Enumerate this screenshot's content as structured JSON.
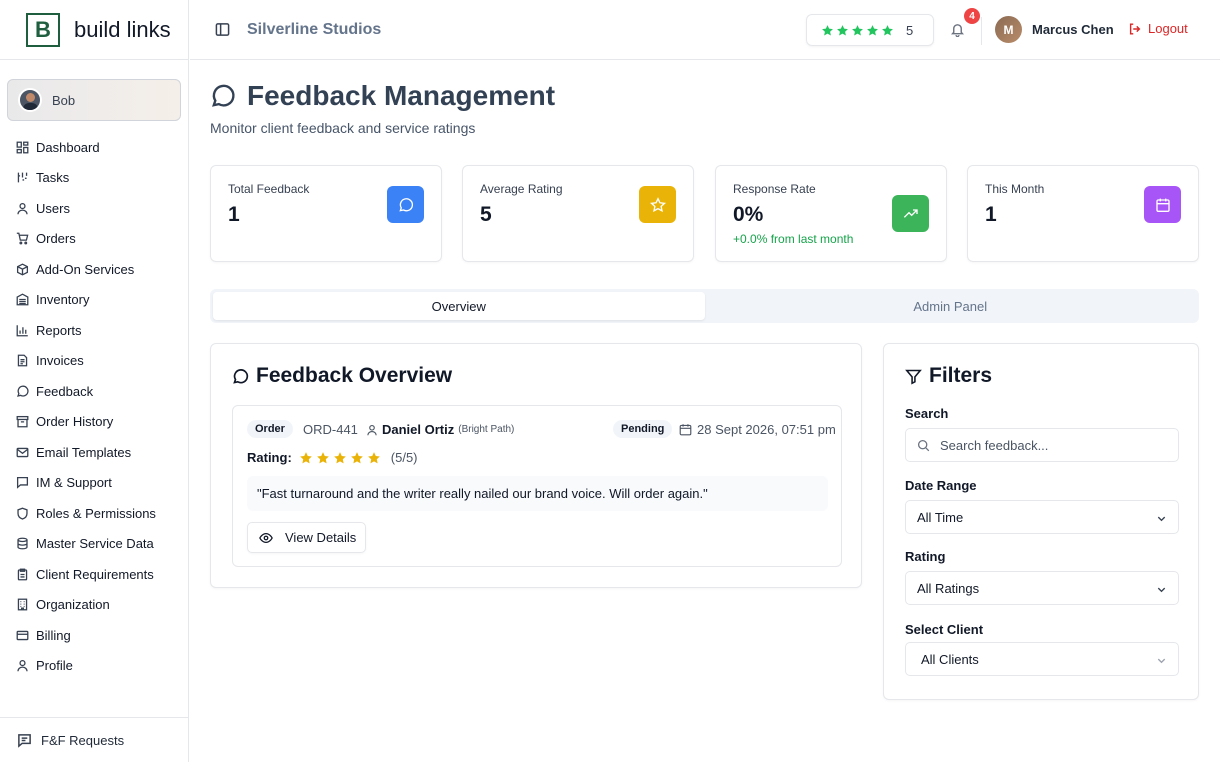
{
  "brand": {
    "logo_letter": "B",
    "name": "build links"
  },
  "sidebar": {
    "user": "Bob",
    "items": [
      {
        "label": "Dashboard",
        "icon": "dashboard-icon"
      },
      {
        "label": "Tasks",
        "icon": "tasks-icon"
      },
      {
        "label": "Users",
        "icon": "user-icon"
      },
      {
        "label": "Orders",
        "icon": "cart-icon"
      },
      {
        "label": "Add-On Services",
        "icon": "package-icon"
      },
      {
        "label": "Inventory",
        "icon": "inventory-icon"
      },
      {
        "label": "Reports",
        "icon": "chart-icon"
      },
      {
        "label": "Invoices",
        "icon": "invoice-icon"
      },
      {
        "label": "Feedback",
        "icon": "message-icon"
      },
      {
        "label": "Order History",
        "icon": "archive-icon"
      },
      {
        "label": "Email Templates",
        "icon": "mail-icon"
      },
      {
        "label": "IM & Support",
        "icon": "chat-icon"
      },
      {
        "label": "Roles & Permissions",
        "icon": "shield-icon"
      },
      {
        "label": "Master Service Data",
        "icon": "database-icon"
      },
      {
        "label": "Client Requirements",
        "icon": "clipboard-icon"
      },
      {
        "label": "Organization",
        "icon": "building-icon"
      },
      {
        "label": "Billing",
        "icon": "credit-card-icon"
      },
      {
        "label": "Profile",
        "icon": "user-icon"
      }
    ],
    "footer": "F&F Requests"
  },
  "topbar": {
    "org": "Silverline Studios",
    "rating_value": "5",
    "rating_stars": 5,
    "notification_count": "4",
    "user_initial": "M",
    "user_name": "Marcus Chen",
    "logout": "Logout"
  },
  "page": {
    "title": "Feedback Management",
    "subtitle": "Monitor client feedback and service ratings"
  },
  "stats": [
    {
      "label": "Total Feedback",
      "value": "1",
      "sub": "",
      "color": "#3b82f6"
    },
    {
      "label": "Average Rating",
      "value": "5",
      "sub": "",
      "color": "#eab308"
    },
    {
      "label": "Response Rate",
      "value": "0%",
      "sub": "+0.0% from last month",
      "color": "#22c55e"
    },
    {
      "label": "This Month",
      "value": "1",
      "sub": "",
      "color": "#a855f7"
    }
  ],
  "tabs": [
    "Overview",
    "Admin Panel"
  ],
  "overview": {
    "title": "Feedback Overview",
    "feedback": {
      "type_badge": "Order",
      "order_id": "ORD-441",
      "client": "Daniel Ortiz",
      "client_org": "(Bright Path)",
      "status": "Pending",
      "date": "28 Sept 2026, 07:51 pm",
      "rating_label": "Rating:",
      "rating_stars": 5,
      "rating_text": "(5/5)",
      "quote": "\"Fast turnaround and the writer really nailed our brand voice. Will order again.\"",
      "view_button": "View Details"
    }
  },
  "filters": {
    "title": "Filters",
    "search_label": "Search",
    "search_placeholder": "Search feedback...",
    "date_label": "Date Range",
    "date_value": "All Time",
    "rating_label": "Rating",
    "rating_value": "All Ratings",
    "client_label": "Select Client",
    "client_value": "All Clients"
  },
  "colors": {
    "star": "#eab308",
    "top_star": "#22c55e",
    "brand": "#1f5f3f",
    "danger": "#dc2626"
  }
}
